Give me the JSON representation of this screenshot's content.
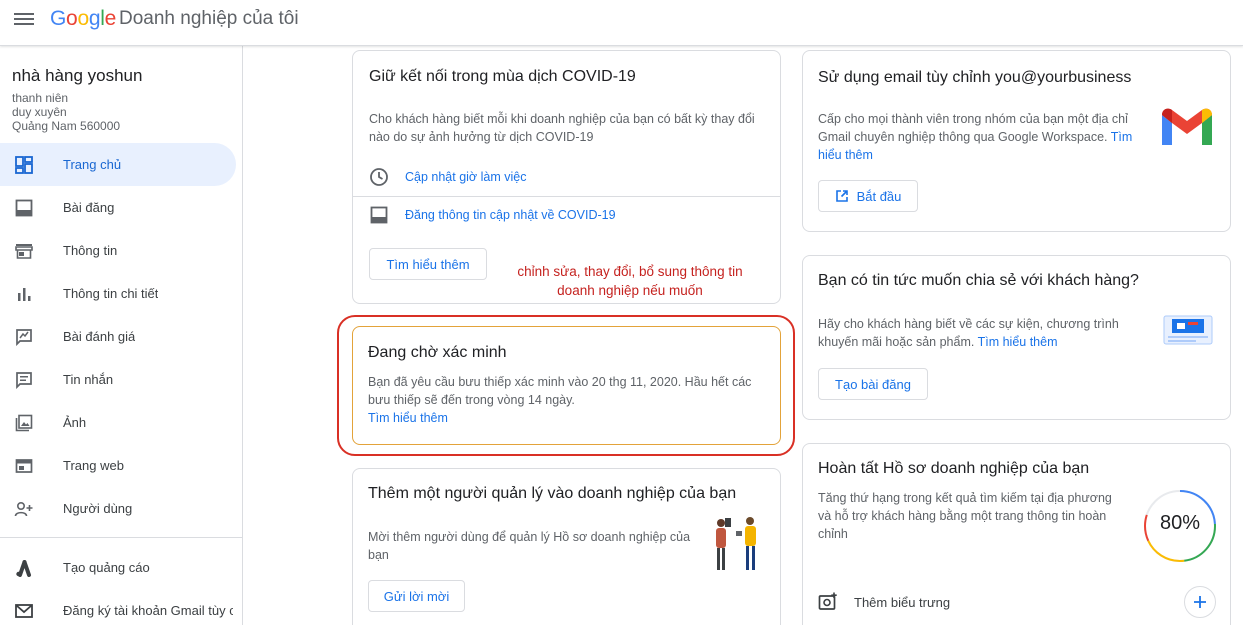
{
  "header": {
    "logo": "Google",
    "title": "Doanh nghiệp của tôi"
  },
  "sidebar": {
    "business_name": "nhà hàng yoshun",
    "address_lines": [
      "thanh niên",
      "duy xuyên",
      "Quảng Nam 560000"
    ],
    "items": [
      {
        "label": "Trang chủ",
        "icon": "dashboard-icon"
      },
      {
        "label": "Bài đăng",
        "icon": "posts-icon"
      },
      {
        "label": "Thông tin",
        "icon": "storefront-icon"
      },
      {
        "label": "Thông tin chi tiết",
        "icon": "bar-chart-icon"
      },
      {
        "label": "Bài đánh giá",
        "icon": "rate-review-icon"
      },
      {
        "label": "Tin nhắn",
        "icon": "message-icon"
      },
      {
        "label": "Ảnh",
        "icon": "photo-icon"
      },
      {
        "label": "Trang web",
        "icon": "web-icon"
      },
      {
        "label": "Người dùng",
        "icon": "add-person-icon"
      }
    ],
    "secondary_items": [
      {
        "label": "Tạo quảng cáo",
        "icon": "google-ads-icon"
      },
      {
        "label": "Đăng ký tài khoản Gmail tùy c...",
        "icon": "gmail-outline-icon"
      }
    ]
  },
  "covid_card": {
    "title": "Giữ kết nối trong mùa dịch COVID-19",
    "text": "Cho khách hàng biết mỗi khi doanh nghiệp của bạn có bất kỳ thay đổi nào do sự ảnh hưởng từ dịch COVID-19",
    "link_hours": "Cập nhật giờ làm việc",
    "link_covid_post": "Đăng thông tin cập nhật về COVID-19",
    "button": "Tìm hiểu thêm"
  },
  "annotation": {
    "line1": "chỉnh sửa, thay đổi, bổ sung thông tin",
    "line2": "doanh nghiệp nếu muốn"
  },
  "verification_card": {
    "title": "Đang chờ xác minh",
    "text": "Bạn đã yêu cầu bưu thiếp xác minh vào 20 thg 11, 2020. Hầu hết các bưu thiếp sẽ đến trong vòng 14 ngày.",
    "link": "Tìm hiểu thêm",
    "border_color": "#e3a33a"
  },
  "manager_card": {
    "title": "Thêm một người quản lý vào doanh nghiệp của bạn",
    "text": "Mời thêm người dùng để quản lý Hồ sơ doanh nghiệp của bạn",
    "button": "Gửi lời mời"
  },
  "email_card": {
    "title": "Sử dụng email tùy chỉnh you@yourbusiness",
    "text": "Cấp cho mọi thành viên trong nhóm của bạn một địa chỉ Gmail chuyên nghiệp thông qua Google Workspace.",
    "link": "Tìm hiểu thêm",
    "button": "Bắt đầu"
  },
  "news_card": {
    "title": "Bạn có tin tức muốn chia sẻ với khách hàng?",
    "text": "Hãy cho khách hàng biết về các sự kiện, chương trình khuyến mãi hoặc sản phẩm.",
    "link": "Tìm hiểu thêm",
    "button": "Tạo bài đăng"
  },
  "profile_card": {
    "title": "Hoàn tất Hồ sơ doanh nghiệp của bạn",
    "text": "Tăng thứ hạng trong kết quả tìm kiếm tại địa phương và hỗ trợ khách hàng bằng một trang thông tin hoàn chỉnh",
    "progress_label": "80%",
    "progress_value": 0.8,
    "add_logo_label": "Thêm biểu trưng"
  },
  "colors": {
    "accent": "#1a73e8",
    "active_bg": "#e8f0fe",
    "annotation_red": "#d93025"
  }
}
